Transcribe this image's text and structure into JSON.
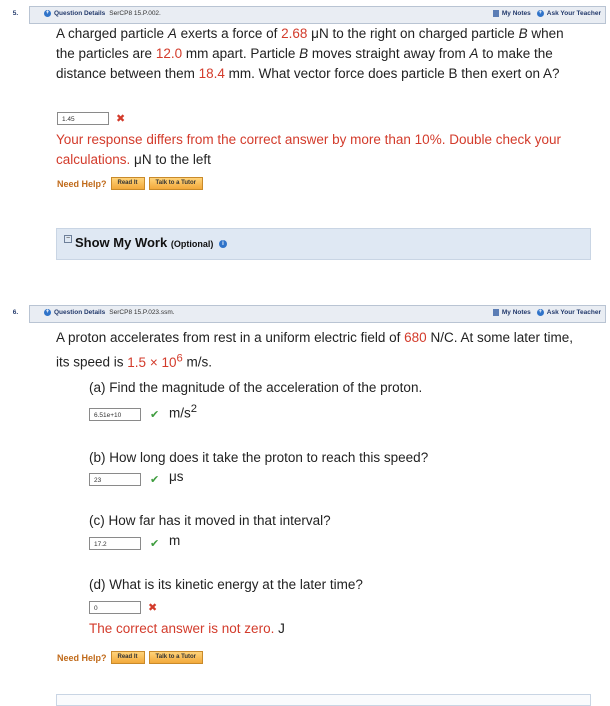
{
  "q5": {
    "number": "5.",
    "details_label": "Question Details",
    "code": "SerCP8 15.P.002.",
    "my_notes": "My Notes",
    "ask_teacher": "Ask Your Teacher",
    "text_1": "A charged particle ",
    "var_a": "A",
    "text_2": " exerts a force of ",
    "force_value": "2.68",
    "text_3": " μN to the right on charged particle ",
    "var_b": "B",
    "text_4": " when the particles are ",
    "dist1": "12.0",
    "text_5": " mm apart. Particle ",
    "var_b2": "B",
    "text_6": " moves straight away from ",
    "var_a2": "A",
    "text_7": " to make the distance between them ",
    "dist2": "18.4",
    "text_8": " mm. What vector force does particle B then exert on A?",
    "answer": "1.45",
    "feedback": "Your response differs from the correct answer by more than 10%. Double check your calculations.",
    "feedback_unit": " μN to the left",
    "need_help": "Need Help?",
    "read_it": "Read It",
    "talk_tutor": "Talk to a Tutor",
    "show_work": "Show My Work",
    "optional": "(Optional)"
  },
  "q6": {
    "number": "6.",
    "details_label": "Question Details",
    "code": "SerCP8 15.P.023.ssm.",
    "my_notes": "My Notes",
    "ask_teacher": "Ask Your Teacher",
    "text_1": "A proton accelerates from rest in a uniform electric field of ",
    "field_value": "680",
    "text_2": " N/C. At some later time, its speed is ",
    "speed_value": "1.5 × 10",
    "speed_exp": "6",
    "text_3": " m/s.",
    "part_a": "(a) Find the magnitude of the acceleration of the proton.",
    "answer_a": "6.51e+10",
    "unit_a": "m/s",
    "unit_a_exp": "2",
    "part_b": "(b) How long does it take the proton to reach this speed?",
    "answer_b": "23",
    "unit_b": "μs",
    "part_c": "(c) How far has it moved in that interval?",
    "answer_c": "17.2",
    "unit_c": "m",
    "part_d": "(d) What is its kinetic energy at the later time?",
    "answer_d": "0",
    "feedback_d": "The correct answer is not zero.",
    "unit_d": " J",
    "need_help": "Need Help?",
    "read_it": "Read It",
    "talk_tutor": "Talk to a Tutor"
  },
  "icons": {
    "plus": "+",
    "info": "i",
    "minus": "−",
    "wrong": "✖",
    "right": "✔"
  },
  "colors": {
    "accent_red": "#d33b2b",
    "correct_green": "#3e9c3e",
    "header_blue": "#233a6c",
    "help_orange": "#c06a1a"
  }
}
